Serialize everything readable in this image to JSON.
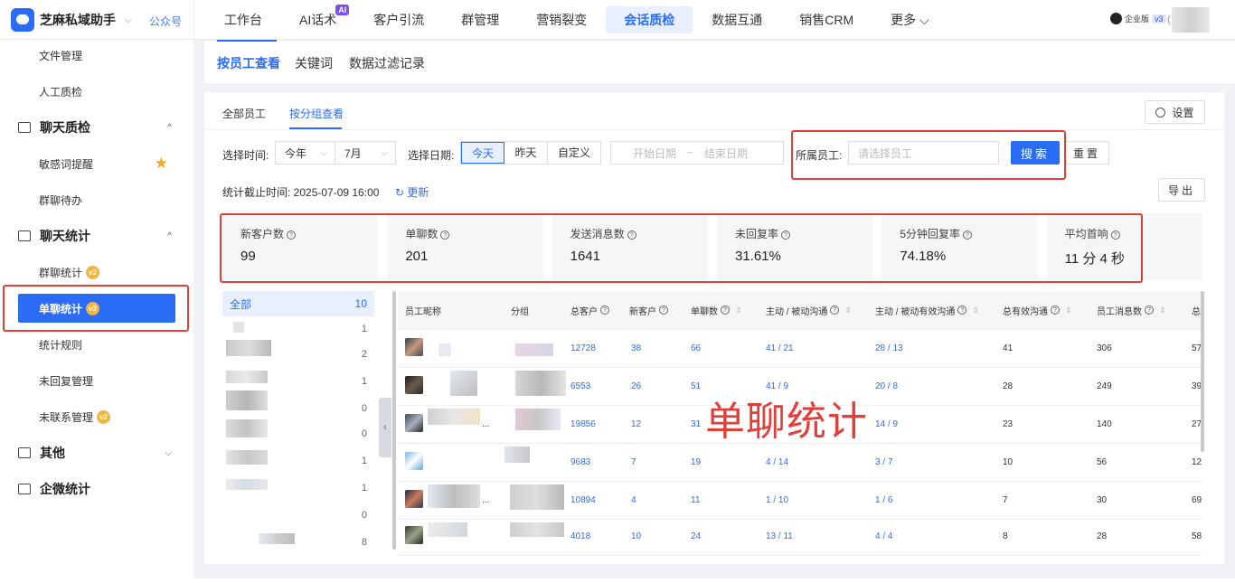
{
  "brand": {
    "name": "芝麻私域助手",
    "caret": "⌵",
    "gzh": "公众号"
  },
  "nav": [
    {
      "label": "工作台"
    },
    {
      "label": "AI话术",
      "badge": "AI"
    },
    {
      "label": "客户引流"
    },
    {
      "label": "群管理"
    },
    {
      "label": "营销裂变"
    },
    {
      "label": "会话质检",
      "active": true
    },
    {
      "label": "数据互通"
    },
    {
      "label": "销售CRM"
    },
    {
      "label": "更多 ⌵"
    }
  ],
  "account": {
    "edition": "企业版",
    "version": "v3",
    "paren": "("
  },
  "sidebar": {
    "items": [
      {
        "label": "文件管理"
      },
      {
        "label": "人工质检"
      },
      {
        "label": "聊天质检",
        "caret": "^"
      },
      {
        "label": "敏感词提醒",
        "star": "★"
      },
      {
        "label": "群聊待办"
      },
      {
        "label": "聊天统计",
        "caret": "^"
      },
      {
        "label": "群聊统计",
        "v2": "v2"
      },
      {
        "label": "单聊统计",
        "v2": "v2"
      },
      {
        "label": "统计规则"
      },
      {
        "label": "未回复管理"
      },
      {
        "label": "未联系管理",
        "v2": "v2"
      },
      {
        "label": "其他",
        "caret": "⌵"
      },
      {
        "label": "企微统计"
      }
    ]
  },
  "subtabs": [
    "按员工查看",
    "关键词",
    "数据过滤记录"
  ],
  "tabs2": [
    "全部员工",
    "按分组查看"
  ],
  "settings_label": "设置",
  "filters": {
    "time_label": "选择时间:",
    "year": "今年",
    "month": "7月",
    "date_label": "选择日期:",
    "seg": [
      "今天",
      "昨天",
      "自定义"
    ],
    "start_ph": "开始日期",
    "tilde": "~",
    "end_ph": "结束日期",
    "staff_label": "所属员工:",
    "staff_ph": "请选择员工",
    "search": "搜索",
    "reset": "重置",
    "cutoff": "统计截止时间: 2025-07-09 16:00",
    "refresh": "更新",
    "export": "导出"
  },
  "stats": [
    {
      "label": "新客户数",
      "value": "99"
    },
    {
      "label": "单聊数",
      "value": "201"
    },
    {
      "label": "发送消息数",
      "value": "1641"
    },
    {
      "label": "未回复率",
      "value": "31.61%"
    },
    {
      "label": "5分钟回复率",
      "value": "74.18%"
    },
    {
      "label": "平均首响",
      "value": "11 分 4 秒"
    }
  ],
  "groups": {
    "all_label": "全部",
    "all_count": "10",
    "counts": [
      "1",
      "2",
      "1",
      "0",
      "0",
      "1",
      "1",
      "0",
      "8"
    ]
  },
  "table": {
    "headers": [
      "员工昵称",
      "分组",
      "总客户",
      "新客户",
      "单聊数",
      "主动 / 被动沟通",
      "主动 / 被动有效沟通",
      "总有效沟通",
      "员工消息数",
      "总"
    ],
    "rows": [
      {
        "total": "12728",
        "new": "38",
        "single": "66",
        "ap": "41 / 21",
        "eff": "28 / 13",
        "total_eff": "41",
        "msgs": "306",
        "more": "57"
      },
      {
        "total": "6553",
        "new": "26",
        "single": "51",
        "ap": "41 / 9",
        "eff": "20 / 8",
        "total_eff": "28",
        "msgs": "249",
        "more": "39"
      },
      {
        "total": "19856",
        "new": "12",
        "single": "31",
        "ap": "",
        "eff": "14 / 9",
        "total_eff": "23",
        "msgs": "140",
        "more": "27"
      },
      {
        "total": "9683",
        "new": "7",
        "single": "19",
        "ap": "4 / 14",
        "eff": "3 / 7",
        "total_eff": "10",
        "msgs": "56",
        "more": "12"
      },
      {
        "total": "10894",
        "new": "4",
        "single": "11",
        "ap": "1 / 10",
        "eff": "1 / 6",
        "total_eff": "7",
        "msgs": "30",
        "more": "69"
      },
      {
        "total": "4018",
        "new": "10",
        "single": "24",
        "ap": "13 / 11",
        "eff": "4 / 4",
        "total_eff": "8",
        "msgs": "28",
        "more": "58"
      }
    ],
    "ellipsis": "..."
  },
  "overlay_text": "单聊统计",
  "colors": {
    "accent": "#2b6cf6",
    "highlight_red": "#e0403a"
  }
}
